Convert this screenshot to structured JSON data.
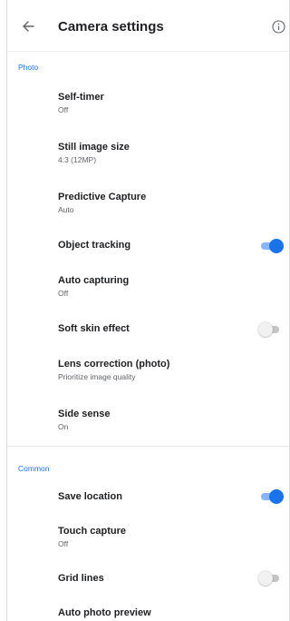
{
  "app_bar": {
    "title": "Camera settings",
    "back_icon": "arrow-back-icon",
    "info_icon": "info-icon"
  },
  "colors": {
    "accent": "#1a73e8",
    "accent_track": "#8ab4f8",
    "text_primary": "#202124",
    "text_secondary": "#5f6368"
  },
  "photo": {
    "header": "Photo",
    "self_timer": {
      "title": "Self-timer",
      "value": "Off"
    },
    "still_image_size": {
      "title": "Still image size",
      "value": "4:3 (12MP)"
    },
    "predictive_capture": {
      "title": "Predictive Capture",
      "value": "Auto"
    },
    "object_tracking": {
      "title": "Object tracking",
      "enabled": true
    },
    "auto_capturing": {
      "title": "Auto capturing",
      "value": "Off"
    },
    "soft_skin_effect": {
      "title": "Soft skin effect",
      "enabled": false
    },
    "lens_correction": {
      "title": "Lens correction (photo)",
      "value": "Prioritize image quality"
    },
    "side_sense": {
      "title": "Side sense",
      "value": "On"
    }
  },
  "common": {
    "header": "Common",
    "save_location": {
      "title": "Save location",
      "enabled": true
    },
    "touch_capture": {
      "title": "Touch capture",
      "value": "Off"
    },
    "grid_lines": {
      "title": "Grid lines",
      "enabled": false
    },
    "auto_photo_preview": {
      "title": "Auto photo preview"
    }
  }
}
